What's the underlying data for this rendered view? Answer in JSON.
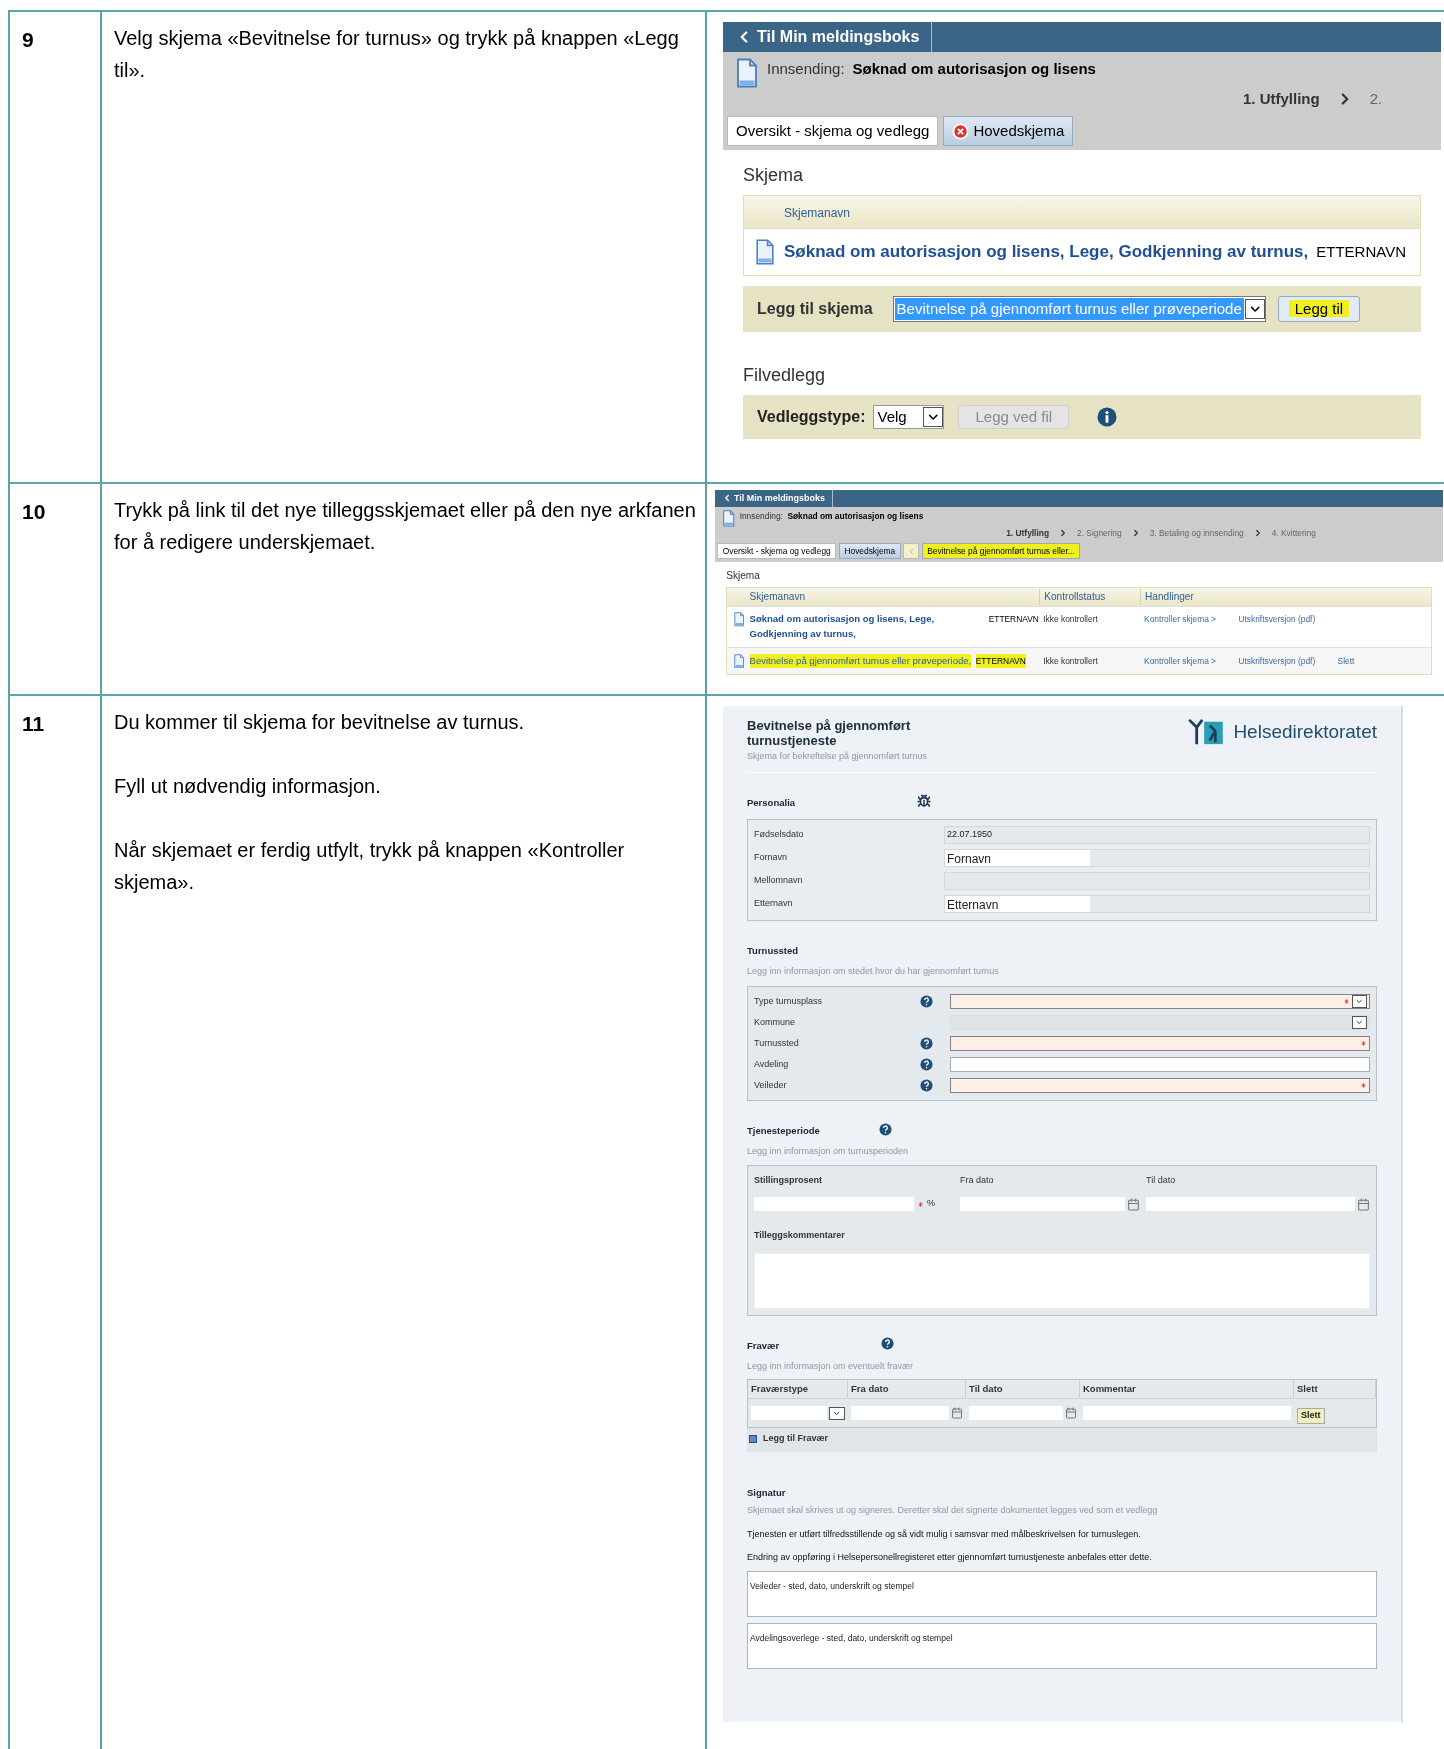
{
  "rows": [
    {
      "step": "9",
      "instructions": [
        "Velg skjema «Bevitnelse for turnus» og trykk på knappen «Legg til»."
      ],
      "screenshot": {
        "kind": "add_form",
        "back_link": "Til Min meldingsboks",
        "submission_label": "Innsending:",
        "submission_title": "Søknad om autorisasjon og lisens",
        "tabs_scrollable": false,
        "steps": [
          {
            "label": "1. Utfylling",
            "selected": true
          },
          {
            "label": "2.",
            "selected": false
          }
        ],
        "tabs": [
          {
            "label": "Oversikt - skjema og vedlegg",
            "selected": true,
            "error": false,
            "highlighted": false
          },
          {
            "label": "Hovedskjema",
            "selected": false,
            "error": true,
            "highlighted": false
          }
        ],
        "section_title": "Skjema",
        "columns": [
          "Skjemanavn"
        ],
        "forms": [
          {
            "name": "Søknad om autorisasjon og lisens, Lege, Godkjenning av turnus,",
            "owner": "ETTERNAVN",
            "highlighted": false
          }
        ],
        "add_label": "Legg til skjema",
        "add_select": "Bevitnelse på gjennomført turnus eller prøveperiode",
        "add_button": {
          "label": "Legg til",
          "highlighted": true
        },
        "attachments_title": "Filvedlegg",
        "attachment_label": "Vedleggstype:",
        "attachment_select": "Velg",
        "attach_button": {
          "label": "Legg ved fil",
          "disabled": true
        }
      }
    },
    {
      "step": "10",
      "instructions": [
        "Trykk på link til det nye tilleggsskjemaet eller på den nye arkfanen for å redigere underskjemaet."
      ],
      "screenshot": {
        "kind": "form_list",
        "back_link": "Til Min meldingsboks",
        "submission_label": "Innsending:",
        "submission_title": "Søknad om autorisasjon og lisens",
        "tabs_scrollable": true,
        "steps": [
          {
            "label": "1. Utfylling",
            "selected": true
          },
          {
            "label": "2. Signering",
            "selected": false
          },
          {
            "label": "3. Betaling og innsending",
            "selected": false
          },
          {
            "label": "4. Kvittering",
            "selected": false
          }
        ],
        "tabs": [
          {
            "label": "Oversikt - skjema og vedlegg",
            "selected": true,
            "error": false,
            "highlighted": false
          },
          {
            "label": "Hovedskjema",
            "selected": false,
            "error": false,
            "highlighted": false
          },
          {
            "label": "Bevitnelse på gjennomført turnus eller...",
            "selected": false,
            "error": false,
            "highlighted": true
          }
        ],
        "section_title": "Skjema",
        "columns": [
          "Skjemanavn",
          "Kontrollstatus",
          "Handlinger"
        ],
        "forms": [
          {
            "name": "Søknad om autorisasjon og lisens, Lege, Godkjenning av turnus,",
            "owner": "ETTERNAVN",
            "highlighted": false,
            "status": "Ikke kontrollert",
            "actions": [
              "Kontroller skjema >",
              "Utskriftsversjon (pdf)"
            ]
          },
          {
            "name": "Bevitnelse på gjennomført turnus eller prøveperiode,",
            "owner": "ETTERNAVN",
            "highlighted": true,
            "status": "Ikke kontrollert",
            "actions": [
              "Kontroller skjema >",
              "Utskriftsversjon (pdf)",
              "Slett"
            ]
          }
        ]
      }
    },
    {
      "step": "11",
      "instructions": [
        "Du kommer til skjema for bevitnelse av turnus.",
        "Fyll ut nødvendig informasjon.",
        "Når skjemaet er ferdig utfylt, trykk på knappen «Kontroller skjema»."
      ],
      "screenshot": {
        "kind": "form",
        "title": "Bevitnelse på gjennomført turnustjeneste",
        "subtitle": "Skjema for bekreftelse på gjennomført turnus",
        "logo_text": "Helsedirektoratet",
        "personalia": {
          "title": "Personalia",
          "fields": [
            {
              "label": "Fødselsdato",
              "value": "22.07.1950",
              "editable": false
            },
            {
              "label": "Fornavn",
              "value": "Fornavn",
              "editable": true
            },
            {
              "label": "Mellomnavn",
              "editable": false
            },
            {
              "label": "Etternavn",
              "value": "Etternavn",
              "editable": true
            }
          ]
        },
        "placement": {
          "title": "Turnussted",
          "hint": "Legg inn informasjon om stedet hvor du har gjennomført turnus",
          "fields": [
            {
              "label": "Type turnusplass",
              "kind": "select",
              "help": true,
              "required": true,
              "disabled": false
            },
            {
              "label": "Kommune",
              "kind": "select",
              "help": false,
              "required": false,
              "disabled": true
            },
            {
              "label": "Turnussted",
              "kind": "text",
              "help": true,
              "required": true,
              "disabled": false
            },
            {
              "label": "Avdeling",
              "kind": "text",
              "help": true,
              "required": false,
              "disabled": false
            },
            {
              "label": "Veileder",
              "kind": "text",
              "help": true,
              "required": true,
              "disabled": false
            }
          ]
        },
        "period": {
          "title": "Tjenesteperiode",
          "hint": "Legg inn informasjon om turnusperioden",
          "percent_label": "Stillingsprosent",
          "percent_unit": "%",
          "from_label": "Fra dato",
          "to_label": "Til dato",
          "comments_label": "Tilleggskommentarer"
        },
        "absence": {
          "title": "Fravær",
          "hint": "Legg inn informasjon om eventuelt fravær",
          "columns": [
            "Fraværstype",
            "Fra dato",
            "Til dato",
            "Kommentar",
            "Slett"
          ],
          "delete_button": "Slett",
          "add_link": "Legg til Fravær"
        },
        "signature": {
          "title": "Signatur",
          "hint": "Skjemaet skal skrives ut og signeres. Deretter skal det signerte dokumentet legges ved som et vedlegg",
          "statements": [
            "Tjenesten er utført tilfredsstillende og så vidt mulig i samsvar med målbeskrivelsen for turnuslegen.",
            "Endring av oppføring i Helsepersonellregisteret etter gjennomført turnustjeneste anbefales etter dette."
          ],
          "boxes": [
            "Veileder - sted, dato, underskrift og stempel",
            "Avdelingsoverlege - sted, dato, underskrift og stempel"
          ]
        }
      }
    }
  ]
}
